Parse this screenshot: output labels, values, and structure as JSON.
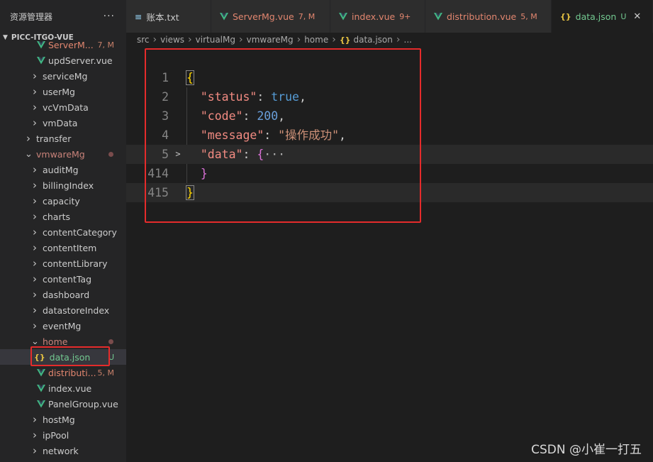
{
  "sidebar": {
    "title": "资源管理器",
    "more": "···",
    "project": "PICC-ITGO-VUE",
    "rows": [
      {
        "label": "ServerM...",
        "badge": "7, M",
        "type": "vue",
        "color": "red",
        "indent": 52
      },
      {
        "label": "updServer.vue",
        "badge": "",
        "type": "vue",
        "color": "white",
        "indent": 52
      },
      {
        "label": "serviceMg",
        "badge": "",
        "type": "folder",
        "color": "white",
        "indent": 44
      },
      {
        "label": "userMg",
        "badge": "",
        "type": "folder",
        "color": "white",
        "indent": 44
      },
      {
        "label": "vcVmData",
        "badge": "",
        "type": "folder",
        "color": "white",
        "indent": 44
      },
      {
        "label": "vmData",
        "badge": "",
        "type": "folder",
        "color": "white",
        "indent": 44
      },
      {
        "label": "transfer",
        "badge": "",
        "type": "folder",
        "color": "white",
        "indent": 35
      },
      {
        "label": "vmwareMg",
        "badge": "",
        "type": "folder-open",
        "color": "pink",
        "indent": 35,
        "dot": true
      },
      {
        "label": "auditMg",
        "badge": "",
        "type": "folder",
        "color": "white",
        "indent": 44
      },
      {
        "label": "billingIndex",
        "badge": "",
        "type": "folder",
        "color": "white",
        "indent": 44
      },
      {
        "label": "capacity",
        "badge": "",
        "type": "folder",
        "color": "white",
        "indent": 44
      },
      {
        "label": "charts",
        "badge": "",
        "type": "folder",
        "color": "white",
        "indent": 44
      },
      {
        "label": "contentCategory",
        "badge": "",
        "type": "folder",
        "color": "white",
        "indent": 44
      },
      {
        "label": "contentItem",
        "badge": "",
        "type": "folder",
        "color": "white",
        "indent": 44
      },
      {
        "label": "contentLibrary",
        "badge": "",
        "type": "folder",
        "color": "white",
        "indent": 44
      },
      {
        "label": "contentTag",
        "badge": "",
        "type": "folder",
        "color": "white",
        "indent": 44
      },
      {
        "label": "dashboard",
        "badge": "",
        "type": "folder",
        "color": "white",
        "indent": 44
      },
      {
        "label": "datastoreIndex",
        "badge": "",
        "type": "folder",
        "color": "white",
        "indent": 44
      },
      {
        "label": "eventMg",
        "badge": "",
        "type": "folder",
        "color": "white",
        "indent": 44
      },
      {
        "label": "home",
        "badge": "",
        "type": "folder-open",
        "color": "pink",
        "indent": 44,
        "dot": true
      },
      {
        "label": "data.json",
        "badge": "U",
        "type": "json",
        "color": "green",
        "indent": 48,
        "selected": true
      },
      {
        "label": "distributi...",
        "badge": "5, M",
        "type": "vue",
        "color": "red",
        "indent": 52
      },
      {
        "label": "index.vue",
        "badge": "",
        "type": "vue",
        "color": "white",
        "indent": 52
      },
      {
        "label": "PanelGroup.vue",
        "badge": "",
        "type": "vue",
        "color": "white",
        "indent": 52
      },
      {
        "label": "hostMg",
        "badge": "",
        "type": "folder",
        "color": "white",
        "indent": 44
      },
      {
        "label": "ipPool",
        "badge": "",
        "type": "folder",
        "color": "white",
        "indent": 44
      },
      {
        "label": "network",
        "badge": "",
        "type": "folder",
        "color": "white",
        "indent": 44
      }
    ]
  },
  "tabs": [
    {
      "label": "账本.txt",
      "mark": "",
      "type": "txt",
      "color": "#cccccc",
      "active": false
    },
    {
      "label": "ServerMg.vue",
      "mark": "7, M",
      "type": "vue",
      "color": "#e2866f",
      "active": false
    },
    {
      "label": "index.vue",
      "mark": "9+",
      "type": "vue",
      "color": "#e2866f",
      "active": false
    },
    {
      "label": "distribution.vue",
      "mark": "5, M",
      "type": "vue",
      "color": "#e2866f",
      "active": false
    },
    {
      "label": "data.json",
      "mark": "U",
      "type": "json",
      "color": "#73c991",
      "active": true,
      "close": "✕"
    }
  ],
  "breadcrumb": [
    "src",
    "views",
    "virtualMg",
    "vmwareMg",
    "home",
    "data.json",
    "..."
  ],
  "editor": {
    "lines": [
      {
        "num": "1",
        "fold": "",
        "tokens": [
          {
            "t": "{",
            "c": "t-brace1"
          }
        ]
      },
      {
        "num": "2",
        "fold": "",
        "tokens": [
          {
            "t": "  ",
            "c": "t-punc"
          },
          {
            "t": "\"status\"",
            "c": "t-key2"
          },
          {
            "t": ": ",
            "c": "t-punc"
          },
          {
            "t": "true",
            "c": "t-bool"
          },
          {
            "t": ",",
            "c": "t-punc"
          }
        ]
      },
      {
        "num": "3",
        "fold": "",
        "tokens": [
          {
            "t": "  ",
            "c": "t-punc"
          },
          {
            "t": "\"code\"",
            "c": "t-key2"
          },
          {
            "t": ": ",
            "c": "t-punc"
          },
          {
            "t": "200",
            "c": "t-num2"
          },
          {
            "t": ",",
            "c": "t-punc"
          }
        ]
      },
      {
        "num": "4",
        "fold": "",
        "tokens": [
          {
            "t": "  ",
            "c": "t-punc"
          },
          {
            "t": "\"message\"",
            "c": "t-key2"
          },
          {
            "t": ": ",
            "c": "t-punc"
          },
          {
            "t": "\"操作成功\"",
            "c": "t-str"
          },
          {
            "t": ",",
            "c": "t-punc"
          }
        ]
      },
      {
        "num": "5",
        "fold": ">",
        "tokens": [
          {
            "t": "  ",
            "c": "t-punc"
          },
          {
            "t": "\"data\"",
            "c": "t-key2"
          },
          {
            "t": ": ",
            "c": "t-punc"
          },
          {
            "t": "{",
            "c": "t-brace2"
          },
          {
            "t": "···",
            "c": "t-ell"
          }
        ]
      },
      {
        "num": "414",
        "fold": "",
        "tokens": [
          {
            "t": "  ",
            "c": "t-punc"
          },
          {
            "t": "}",
            "c": "t-brace2"
          }
        ]
      },
      {
        "num": "415",
        "fold": "",
        "tokens": [
          {
            "t": "}",
            "c": "t-brace1"
          }
        ]
      }
    ]
  },
  "watermark": "CSDN @小崔一打五",
  "colors": {
    "vue": "#41b883",
    "json": "#e8c442",
    "highlight": "#e52b2b"
  }
}
